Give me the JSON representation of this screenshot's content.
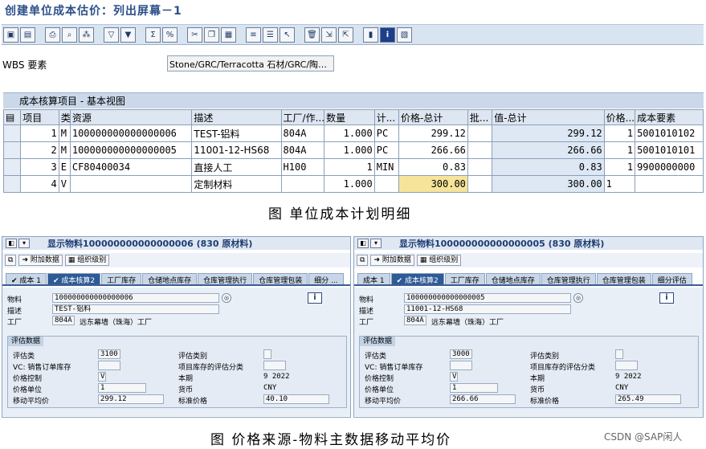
{
  "page_title": "创建单位成本估价：列出屏幕－1",
  "toolbar": {
    "icons": [
      "save-icon",
      "print-doc-icon",
      "print-icon",
      "find-icon",
      "find-next-icon",
      "filter-icon",
      "set-filter-icon",
      "sum-icon",
      "subtotal-icon",
      "cut-icon",
      "copy-icon",
      "paste-icon",
      "insert-row-icon",
      "append-row-icon",
      "select-icon",
      "delete-icon",
      "export-icon",
      "import-icon",
      "chart-icon",
      "info-icon",
      "layout-icon"
    ]
  },
  "wbs": {
    "label": "WBS 要素",
    "value": "Stone/GRC/Terracotta 石材/GRC/陶…"
  },
  "grid": {
    "title": "成本核算项目 - 基本视图",
    "columns": [
      "项目",
      "类",
      "资源",
      "描述",
      "工厂/作...",
      "数量",
      "计...",
      "价格-总计",
      "批...",
      "值-总计",
      "价格...",
      "成本要素"
    ],
    "rows": [
      {
        "item": "1",
        "type": "M",
        "resource": "100000000000000006",
        "desc": "TEST-铝料",
        "plant": "804A",
        "qty": "1.000",
        "unit": "PC",
        "price": "299.12",
        "lot": "",
        "value": "299.12",
        "pu": "1",
        "ce": "5001010102"
      },
      {
        "item": "2",
        "type": "M",
        "resource": "100000000000000005",
        "desc": "11001-12-HS68",
        "plant": "804A",
        "qty": "1.000",
        "unit": "PC",
        "price": "266.66",
        "lot": "",
        "value": "266.66",
        "pu": "1",
        "ce": "5001010101"
      },
      {
        "item": "3",
        "type": "E",
        "resource": "CF80400034",
        "desc": "直接人工",
        "plant": "H100",
        "qty": "1",
        "unit": "MIN",
        "price": "0.83",
        "lot": "",
        "value": "0.83",
        "pu": "1",
        "ce": "9900000000"
      },
      {
        "item": "4",
        "type": "V",
        "resource": "",
        "desc": "定制材料",
        "plant": "",
        "qty": "1.000",
        "unit": "",
        "price": "300.00",
        "lot": "",
        "value": "300.00",
        "pu": "1",
        "ce": ""
      }
    ]
  },
  "caption1": "图  单位成本计划明细",
  "caption2": "图  价格来源-物料主数据移动平均价",
  "watermark": "CSDN @SAP闲人",
  "panels": [
    {
      "title": "显示物料100000000000000006 (830 原材料)",
      "btn_additional": "附加数据",
      "btn_org": "组织级别",
      "tabs": [
        "成本 1",
        "成本核算2",
        "工厂库存",
        "仓储地点库存",
        "仓库管理执行",
        "仓库管理包装",
        "细分 ..."
      ],
      "material_label": "物料",
      "material": "100000000000000006",
      "desc_label": "描述",
      "desc": "TEST-铝料",
      "plant_label": "工厂",
      "plant": "804A",
      "plant_name": "远东幕墙（珠海）工厂",
      "section": "评估数据",
      "val_class_label": "评估类",
      "val_class": "3100",
      "vc_label": "VC: 销售订单库存",
      "price_ctrl_label": "价格控制",
      "price_ctrl": "V",
      "price_unit_label": "价格单位",
      "price_unit": "1",
      "map_label": "移动平均价",
      "map": "299.12",
      "val_cat_label": "评估类别",
      "proj_label": "项目库存的评估分类",
      "period_label": "本期",
      "period": "9  2022",
      "currency_label": "货币",
      "currency": "CNY",
      "std_label": "标准价格",
      "std": "40.10"
    },
    {
      "title": "显示物料100000000000000005 (830 原材料)",
      "btn_additional": "附加数据",
      "btn_org": "组织级别",
      "tabs": [
        "成本 1",
        "成本核算2",
        "工厂库存",
        "仓储地点库存",
        "仓库管理执行",
        "仓库管理包装",
        "细分评估"
      ],
      "material_label": "物料",
      "material": "100000000000000005",
      "desc_label": "描述",
      "desc": "11001-12-HS68",
      "plant_label": "工厂",
      "plant": "804A",
      "plant_name": "远东幕墙（珠海）工厂",
      "section": "评估数据",
      "val_class_label": "评估类",
      "val_class": "3000",
      "vc_label": "VC: 销售订单库存",
      "price_ctrl_label": "价格控制",
      "price_ctrl": "V",
      "price_unit_label": "价格单位",
      "price_unit": "1",
      "map_label": "移动平均价",
      "map": "266.66",
      "val_cat_label": "评估类别",
      "proj_label": "项目库存的评估分类",
      "period_label": "本期",
      "period": "9  2022",
      "currency_label": "货币",
      "currency": "CNY",
      "std_label": "标准价格",
      "std": "265.49"
    }
  ]
}
